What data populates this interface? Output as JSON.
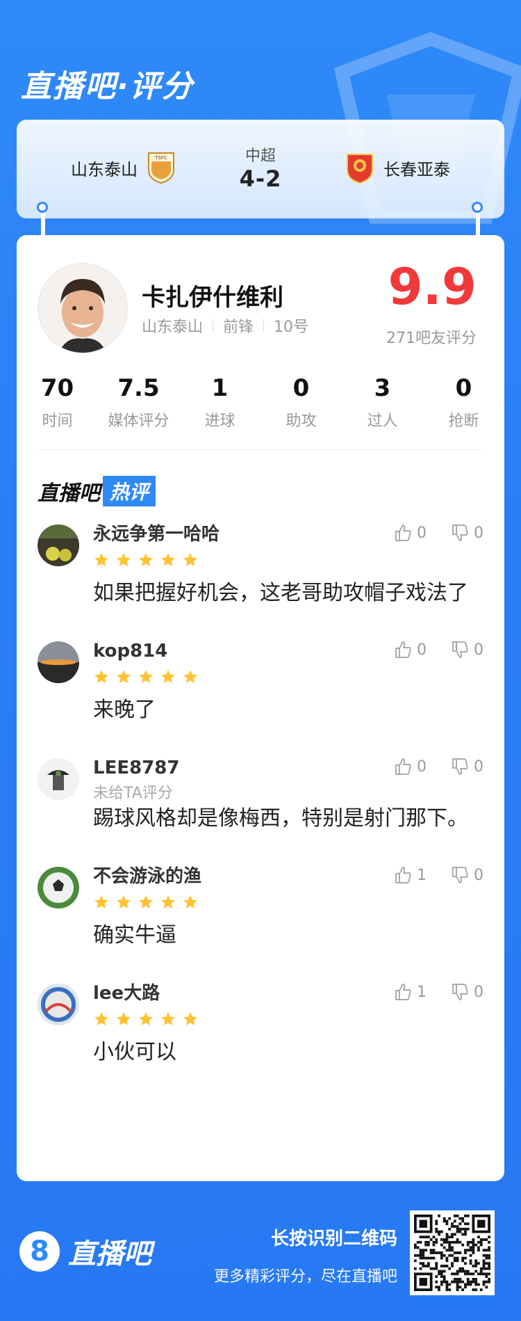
{
  "brand": {
    "title": "直播吧·评分"
  },
  "match": {
    "league": "中超",
    "score": "4-2",
    "home_team": "山东泰山",
    "away_team": "长春亚泰",
    "home_crest_text": "TSFC"
  },
  "player": {
    "name": "卡扎伊什维利",
    "team": "山东泰山",
    "position": "前锋",
    "number": "10号",
    "rating": "9.9",
    "rating_count": "271吧友评分"
  },
  "stats": [
    {
      "value": "70",
      "label": "时间"
    },
    {
      "value": "7.5",
      "label": "媒体评分"
    },
    {
      "value": "1",
      "label": "进球"
    },
    {
      "value": "0",
      "label": "助攻"
    },
    {
      "value": "3",
      "label": "过人"
    },
    {
      "value": "0",
      "label": "抢断"
    }
  ],
  "hot_section": {
    "brand": "直播吧",
    "tag": "热评"
  },
  "comments": [
    {
      "user": "永远争第一哈哈",
      "stars": 5,
      "sub": "",
      "text": "如果把握好机会，这老哥助攻帽子戏法了",
      "likes": "0",
      "dislikes": "0"
    },
    {
      "user": "kop814",
      "stars": 5,
      "sub": "",
      "text": "来晚了",
      "likes": "0",
      "dislikes": "0"
    },
    {
      "user": "LEE8787",
      "stars": 0,
      "sub": "未给TA评分",
      "text": "踢球风格却是像梅西，特别是射门那下。",
      "likes": "0",
      "dislikes": "0"
    },
    {
      "user": "不会游泳的渔",
      "stars": 5,
      "sub": "",
      "text": "确实牛逼",
      "likes": "1",
      "dislikes": "0"
    },
    {
      "user": "lee大路",
      "stars": 5,
      "sub": "",
      "text": "小伙可以",
      "likes": "1",
      "dislikes": "0"
    }
  ],
  "footer": {
    "logo_number": "8",
    "logo_text": "直播吧",
    "cta_main": "长按识别二维码",
    "cta_sub": "更多精彩评分，尽在直播吧"
  },
  "colors": {
    "brand_blue": "#2f8af8",
    "rating_red": "#f0393a",
    "star_yellow": "#ffc233"
  }
}
